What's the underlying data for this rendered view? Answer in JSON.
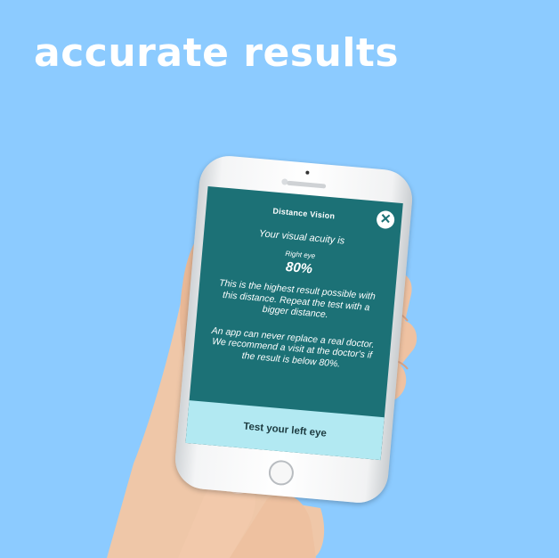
{
  "headline": "accurate results",
  "screen": {
    "title": "Distance Vision",
    "close_icon": "close-icon",
    "acuity_text": "Your visual acuity is",
    "eye_label": "Right eye",
    "percent": "80%",
    "note1": "This is the highest result possible with this distance. Repeat the test with a bigger distance.",
    "note2": "An app can never replace a real doctor. We recommend a visit at the doctor's if the result is below 80%.",
    "cta_label": "Test your left eye"
  },
  "colors": {
    "background": "#8ccbff",
    "screen": "#1c7176",
    "cta_background": "#b2e9f2"
  }
}
